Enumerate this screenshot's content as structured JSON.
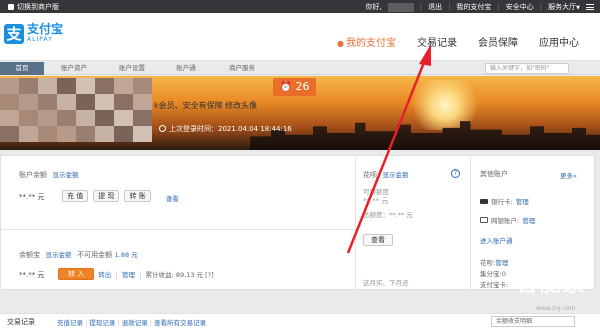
{
  "topbar": {
    "switch_label": "切换到商户版",
    "greeting": "你好,",
    "logout": "退出",
    "my_alipay": "我的支付宝",
    "security": "安全中心",
    "service": "服务大厅",
    "service_caret": "▼",
    "sep": "|"
  },
  "logo": {
    "mark": "支",
    "cn": "支付宝",
    "en": "ALIPAY"
  },
  "mainnav": {
    "items": [
      {
        "label": "我的支付宝",
        "active": true
      },
      {
        "label": "交易记录",
        "active": false
      },
      {
        "label": "会员保障",
        "active": false
      },
      {
        "label": "应用中心",
        "active": false
      }
    ],
    "active_dot": "●"
  },
  "subnav": {
    "tabs": [
      "首页",
      "账户资产",
      "账户设置",
      "账户通",
      "商户服务"
    ],
    "search_placeholder": "输入关键字，如\"密码\""
  },
  "banner": {
    "alarm_count": "26",
    "alarm_icon": "⏰",
    "security_text": "k会员、安全有保障 修改头像",
    "login_time": "上次登录时间：2021.04.04 18:44:16"
  },
  "balance": {
    "title": "账户余额",
    "show_link": "显示金额",
    "amount": "**.** 元",
    "buttons": [
      "充 值",
      "提 现",
      "转 账"
    ],
    "view_link": "查看"
  },
  "yuebao": {
    "title": "余额宝",
    "show_link": "显示金额",
    "unavailable_label": "不可用金额",
    "unavailable_value": "1.88 元",
    "amount": "**.** 元",
    "transfer_in": "转 入",
    "transfer_out": "转出",
    "manage": "管理",
    "earnings": "累计收益: 89.13 元 [?]",
    "sep": "|"
  },
  "huabei": {
    "title": "花呗",
    "show_link": "显示金额",
    "help": "?",
    "available_label": "可用额度",
    "available_value": "**.** 元",
    "total_label": "总额度：",
    "total_value": "**.** 元",
    "view_button": "查看",
    "footer_text": "这月买、下月还"
  },
  "other": {
    "title": "其他账户",
    "more": "更多»",
    "bank_label": "银行卡:",
    "bank_manage": "管理",
    "netbank_label": "网银账户:",
    "netbank_manage": "管理",
    "enter_link": "进入账户通",
    "huabei_label": "花呗:",
    "huabei_manage": "管理",
    "jifen_label": "集分宝:",
    "jifen_value": "0",
    "pay_label": "支付宝卡:"
  },
  "records": {
    "title": "交易记录",
    "links": [
      "充值记录",
      "提现记录",
      "退款记录",
      "查看所有交易记录"
    ],
    "select_value": "余额收支明细",
    "sep": "|"
  },
  "watermark": {
    "text": "智能家",
    "url": "www.znj.com"
  },
  "colors": {
    "accent": "#e8703a",
    "link": "#2b6bb3",
    "brand": "#1a8fe1",
    "arrow": "#e8202a"
  }
}
